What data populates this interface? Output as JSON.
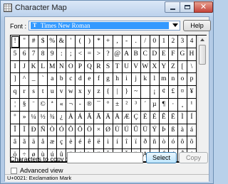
{
  "window": {
    "title": "Character Map"
  },
  "font": {
    "label": "Font :",
    "selected": "Times New Roman",
    "help_label": "Help"
  },
  "grid": {
    "selected_index": 0,
    "rows": [
      [
        "!",
        "\"",
        "#",
        "$",
        "%",
        "&",
        "'",
        "(",
        ")",
        "*",
        "+",
        ",",
        "-",
        ".",
        "/",
        "0",
        "1",
        "2",
        "3",
        "4"
      ],
      [
        "5",
        "6",
        "7",
        "8",
        "9",
        ":",
        ";",
        "<",
        "=",
        ">",
        "?",
        "@",
        "A",
        "B",
        "C",
        "D",
        "E",
        "F",
        "G",
        "H"
      ],
      [
        "I",
        "J",
        "K",
        "L",
        "M",
        "N",
        "O",
        "P",
        "Q",
        "R",
        "S",
        "T",
        "U",
        "V",
        "W",
        "X",
        "Y",
        "Z",
        "[",
        "\\"
      ],
      [
        "]",
        "^",
        "_",
        "`",
        "a",
        "b",
        "c",
        "d",
        "e",
        "f",
        "g",
        "h",
        "i",
        "j",
        "k",
        "l",
        "m",
        "n",
        "o",
        "p"
      ],
      [
        "q",
        "r",
        "s",
        "t",
        "u",
        "v",
        "w",
        "x",
        "y",
        "z",
        "{",
        "|",
        "}",
        "~",
        "",
        "¡",
        "¢",
        "£",
        "¤",
        "¥"
      ],
      [
        "¦",
        "§",
        "¨",
        "©",
        "ª",
        "«",
        "¬",
        "-",
        "®",
        "¯",
        "°",
        "±",
        "²",
        "³",
        "´",
        "µ",
        "¶",
        "·",
        "¸",
        "¹"
      ],
      [
        "º",
        "»",
        "¼",
        "½",
        "¾",
        "¿",
        "À",
        "Á",
        "Â",
        "Ã",
        "Ä",
        "Å",
        "Æ",
        "Ç",
        "È",
        "É",
        "Ê",
        "Ë",
        "Ì",
        "Í"
      ],
      [
        "Î",
        "Ï",
        "Ð",
        "Ñ",
        "Ò",
        "Ó",
        "Ô",
        "Õ",
        "Ö",
        "×",
        "Ø",
        "Ù",
        "Ú",
        "Û",
        "Ü",
        "Ý",
        "Þ",
        "ß",
        "à",
        "á"
      ],
      [
        "â",
        "ã",
        "ä",
        "å",
        "æ",
        "ç",
        "è",
        "é",
        "ê",
        "ë",
        "ì",
        "í",
        "î",
        "ï",
        "ð",
        "ñ",
        "ò",
        "ó",
        "ô",
        "õ"
      ],
      [
        "ö",
        "÷",
        "ø",
        "ù",
        "ú",
        "û",
        "ü",
        "ý",
        "þ",
        "ÿ",
        "Ā",
        "ā",
        "Ă",
        "ă",
        "Ą",
        "ą",
        "Ć",
        "ć",
        "Ĉ",
        "ĉ"
      ]
    ]
  },
  "copy": {
    "label": "Characters to copy :",
    "value": "",
    "select_label": "Select",
    "copy_label": "Copy"
  },
  "advanced": {
    "label": "Advanced view",
    "checked": false
  },
  "status": {
    "text": "U+0021: Exclamation Mark"
  },
  "colors": {
    "selection": "#3399ff",
    "close_button": "#c4433a"
  }
}
